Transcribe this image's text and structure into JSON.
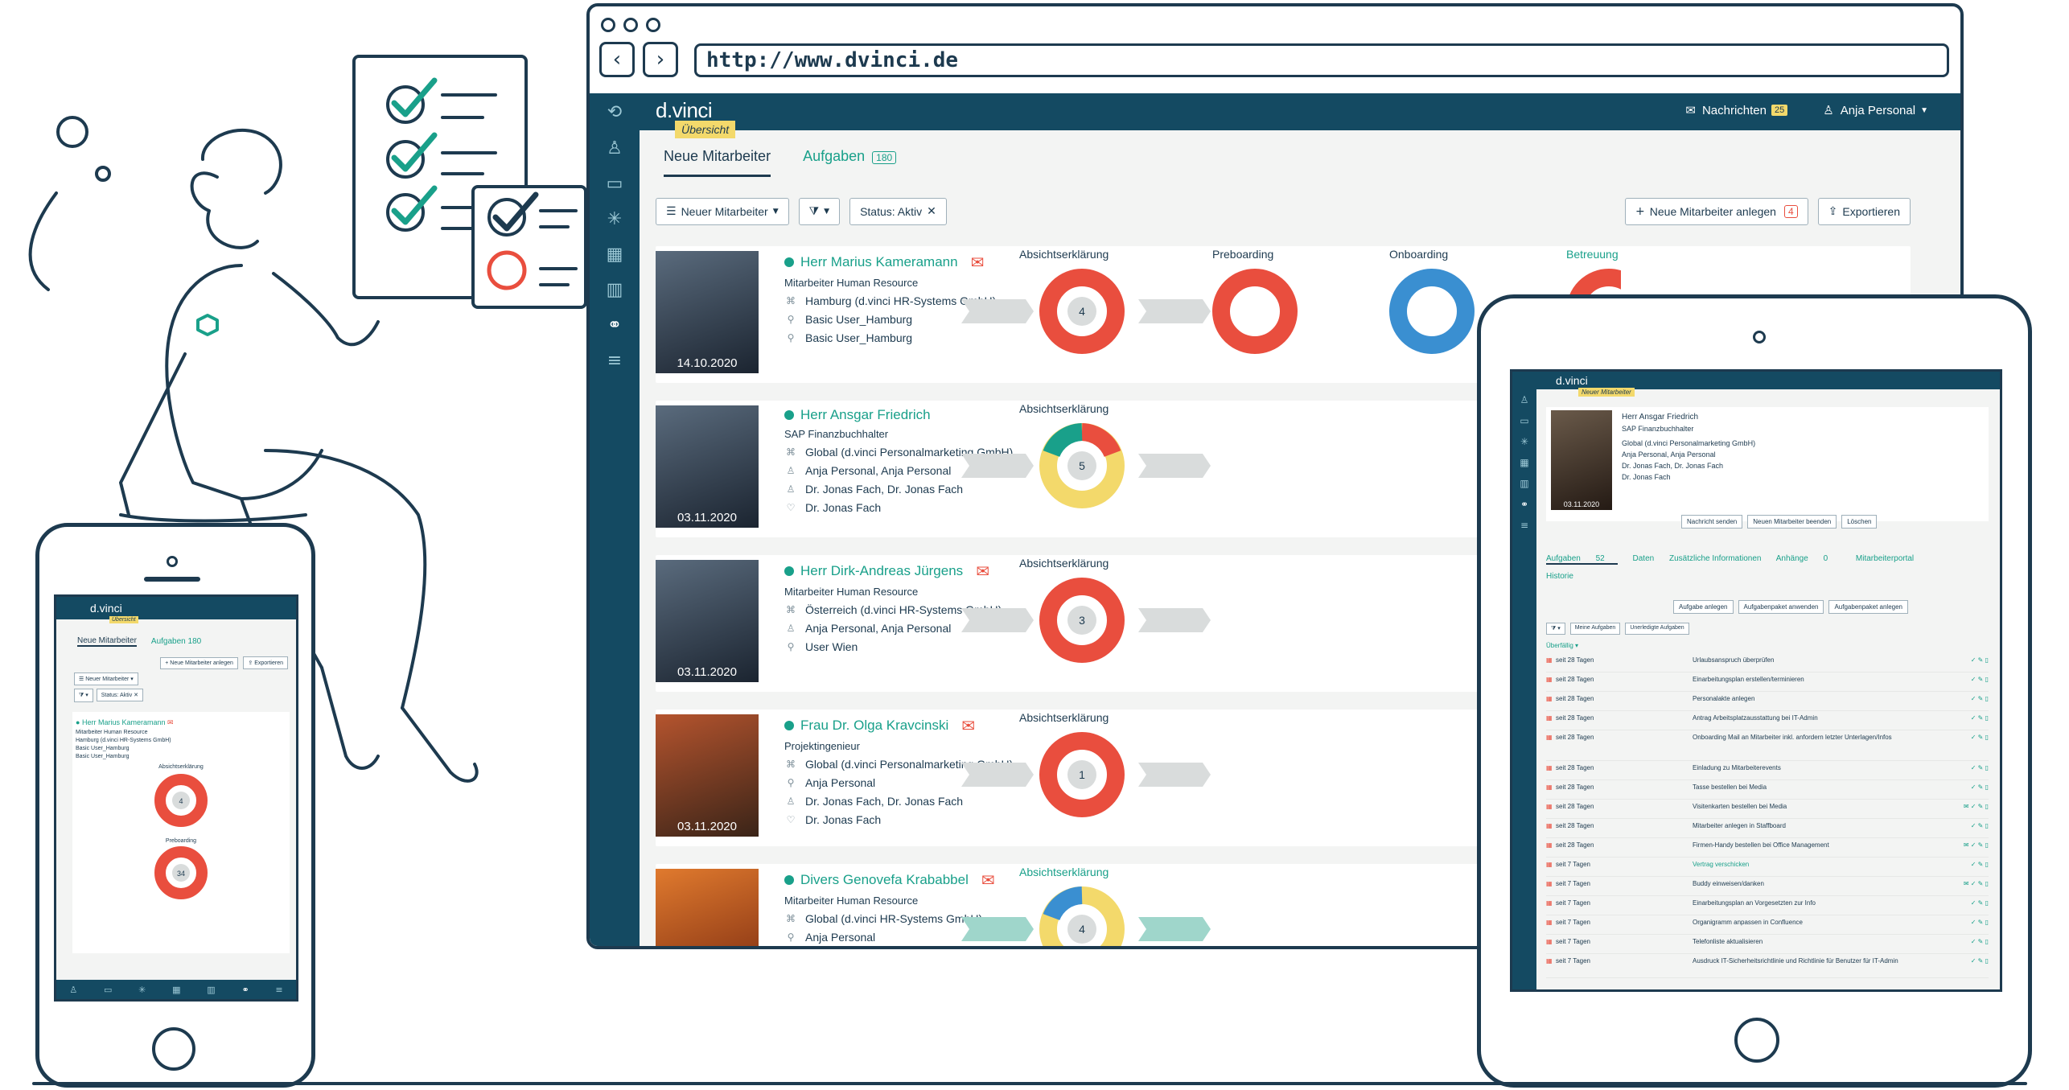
{
  "browser": {
    "url": "http://www.dvinci.de"
  },
  "app": {
    "brand": "d.vinci",
    "brand_tag": "Übersicht",
    "messages_label": "Nachrichten",
    "messages_count": "25",
    "user_label": "Anja Personal"
  },
  "tabs": [
    {
      "label": "Neue Mitarbeiter"
    },
    {
      "label": "Aufgaben",
      "count": "180"
    }
  ],
  "toolbar": {
    "view_select": "Neuer Mitarbeiter",
    "status_filter": "Status: Aktiv",
    "new_button": "Neue Mitarbeiter anlegen",
    "new_count": "4",
    "export_button": "Exportieren"
  },
  "stages": [
    "Absichtserklärung",
    "Preboarding",
    "Onboarding",
    "Betreuung"
  ],
  "employees": [
    {
      "name": "Herr Marius Kameramann",
      "role": "Mitarbeiter Human Resource",
      "date": "14.10.2020",
      "line1": "Hamburg (d.vinci HR-Systems GmbH)",
      "line2": "Basic User_Hamburg",
      "line3": "Basic User_Hamburg",
      "line4": "",
      "count": "4"
    },
    {
      "name": "Herr Ansgar Friedrich",
      "role": "SAP Finanzbuchhalter",
      "date": "03.11.2020",
      "line1": "Global (d.vinci Personalmarketing GmbH)",
      "line2": "Anja Personal, Anja Personal",
      "line3": "Dr. Jonas Fach, Dr. Jonas Fach",
      "line4": "Dr. Jonas Fach",
      "count": "5"
    },
    {
      "name": "Herr Dirk-Andreas Jürgens",
      "role": "Mitarbeiter Human Resource",
      "date": "03.11.2020",
      "line1": "Österreich (d.vinci HR-Systems GmbH)",
      "line2": "Anja Personal, Anja Personal",
      "line3": "User Wien",
      "line4": "",
      "count": "3"
    },
    {
      "name": "Frau Dr. Olga Kravcinski",
      "role": "Projektingenieur",
      "date": "03.11.2020",
      "line1": "Global (d.vinci Personalmarketing GmbH)",
      "line2": "Anja Personal",
      "line3": "Dr. Jonas Fach, Dr. Jonas Fach",
      "line4": "Dr. Jonas Fach",
      "count": "1"
    },
    {
      "name": "Divers Genovefa Krababbel",
      "role": "Mitarbeiter Human Resource",
      "date": "",
      "line1": "Global (d.vinci HR-Systems GmbH)",
      "line2": "Anja Personal",
      "line3": "",
      "line4": "",
      "count": "4"
    }
  ],
  "tablet": {
    "brand": "d.vinci",
    "tag": "Neuer Mitarbeiter",
    "name": "Herr Ansgar Friedrich",
    "role": "SAP Finanzbuchhalter",
    "l1": "Global (d.vinci Personalmarketing GmbH)",
    "l2": "Anja Personal, Anja Personal",
    "l3": "Dr. Jonas Fach, Dr. Jonas Fach",
    "l4": "Dr. Jonas Fach",
    "date": "03.11.2020",
    "btn1": "Nachricht senden",
    "btn2": "Neuen Mitarbeiter beenden",
    "btn3": "Löschen",
    "tab1": "Aufgaben",
    "tab1_count": "52",
    "tab2": "Daten",
    "tab3": "Zusätzliche Informationen",
    "tab4": "Anhänge",
    "tab4_count": "0",
    "tab5": "Mitarbeiterportal",
    "tab6": "Historie",
    "tool1": "Aufgabe anlegen",
    "tool2": "Aufgabenpaket anwenden",
    "tool3": "Aufgabenpaket anlegen",
    "filter1": "Meine Aufgaben",
    "filter2": "Unerledigte Aufgaben",
    "overdue": "Überfällig",
    "tasks": [
      {
        "since": "seit 28 Tagen",
        "task": "Urlaubsanspruch überprüfen"
      },
      {
        "since": "seit 28 Tagen",
        "task": "Einarbeitungsplan erstellen/terminieren"
      },
      {
        "since": "seit 28 Tagen",
        "task": "Personalakte anlegen"
      },
      {
        "since": "seit 28 Tagen",
        "task": "Antrag Arbeitsplatzausstattung bei IT-Admin"
      },
      {
        "since": "seit 28 Tagen",
        "task": "Onboarding Mail an Mitarbeiter inkl. anfordern letzter Unterlagen/Infos"
      },
      {
        "since": "seit 28 Tagen",
        "task": "Einladung zu Mitarbeiterevents"
      },
      {
        "since": "seit 28 Tagen",
        "task": "Tasse bestellen bei Media"
      },
      {
        "since": "seit 28 Tagen",
        "task": "Visitenkarten bestellen bei Media"
      },
      {
        "since": "seit 28 Tagen",
        "task": "Mitarbeiter anlegen in Staffboard"
      },
      {
        "since": "seit 28 Tagen",
        "task": "Firmen-Handy bestellen bei Office Management"
      },
      {
        "since": "seit 7 Tagen",
        "task": "Vertrag verschicken"
      },
      {
        "since": "seit 7 Tagen",
        "task": "Buddy einweisen/danken"
      },
      {
        "since": "seit 7 Tagen",
        "task": "Einarbeitungsplan an Vorgesetzten zur Info"
      },
      {
        "since": "seit 7 Tagen",
        "task": "Organigramm anpassen in Confluence"
      },
      {
        "since": "seit 7 Tagen",
        "task": "Telefonliste aktualisieren"
      },
      {
        "since": "seit 7 Tagen",
        "task": "Ausdruck IT-Sicherheitsrichtlinie und Richtlinie für Benutzer für IT-Admin"
      }
    ]
  },
  "phone": {
    "brand": "d.vinci",
    "tag": "Übersicht",
    "tab1": "Neue Mitarbeiter",
    "tab2": "Aufgaben",
    "tab2_count": "180",
    "btn_new": "Neue Mitarbeiter anlegen",
    "btn_export": "Exportieren",
    "select": "Neuer Mitarbeiter",
    "filter": "Status: Aktiv",
    "name": "Herr Marius Kameramann",
    "role": "Mitarbeiter Human Resource",
    "l1": "Hamburg (d.vinci HR-Systems GmbH)",
    "l2": "Basic User_Hamburg",
    "l3": "Basic User_Hamburg",
    "stage1": "Absichtserklärung",
    "stage1_count": "4",
    "stage2": "Preboarding",
    "stage2_count": "34"
  },
  "colors": {
    "navy": "#144a62",
    "teal": "#19a08a",
    "red": "#e94e3e",
    "yellow": "#f3d96b",
    "blue": "#3a8fd1"
  }
}
